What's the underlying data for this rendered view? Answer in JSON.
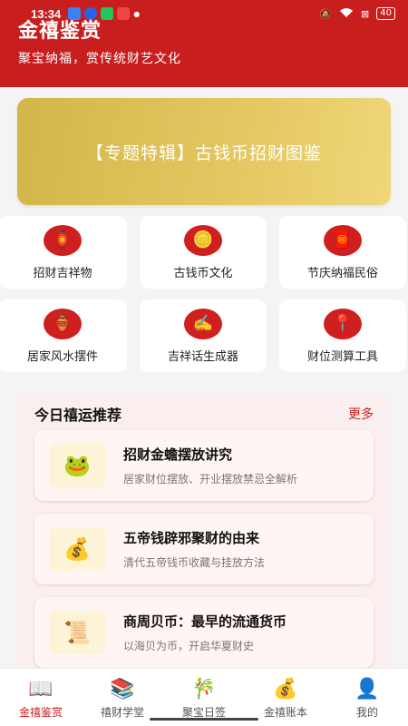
{
  "status": {
    "time": "13:34",
    "battery": "40"
  },
  "header": {
    "title": "金禧鉴赏",
    "subtitle": "聚宝纳福，赏传统财艺文化"
  },
  "banner": {
    "text": "【专题特辑】古钱币招财图鉴"
  },
  "categories": [
    {
      "label": "招财吉祥物",
      "icon": "lantern-icon",
      "glyph": "🏮"
    },
    {
      "label": "古钱币文化",
      "icon": "coin-icon",
      "glyph": "🪙"
    },
    {
      "label": "节庆纳福民俗",
      "icon": "red-envelope-icon",
      "glyph": "🧧"
    },
    {
      "label": "居家风水摆件",
      "icon": "vase-icon",
      "glyph": "🏺"
    },
    {
      "label": "吉祥话生成器",
      "icon": "writing-hand-icon",
      "glyph": "✍️"
    },
    {
      "label": "财位测算工具",
      "icon": "pin-icon",
      "glyph": "📍"
    }
  ],
  "recommend": {
    "title": "今日禧运推荐",
    "more": "更多",
    "items": [
      {
        "title": "招财金蟾摆放讲究",
        "desc": "居家财位摆放、开业摆放禁忌全解析",
        "icon": "frog-icon",
        "glyph": "🐸"
      },
      {
        "title": "五帝钱辟邪聚财的由来",
        "desc": "清代五帝钱币收藏与挂放方法",
        "icon": "money-bag-icon",
        "glyph": "💰"
      },
      {
        "title": "商周贝币：最早的流通货币",
        "desc": "以海贝为币，开启华夏财史",
        "icon": "scroll-icon",
        "glyph": "📜"
      }
    ]
  },
  "tabs": [
    {
      "label": "金禧鉴赏",
      "icon": "book-icon",
      "glyph": "📖",
      "active": true
    },
    {
      "label": "禧财学堂",
      "icon": "books-icon",
      "glyph": "📚",
      "active": false
    },
    {
      "label": "聚宝日签",
      "icon": "bamboo-icon",
      "glyph": "🎋",
      "active": false
    },
    {
      "label": "金禧账本",
      "icon": "money-bag-icon",
      "glyph": "💰",
      "active": false
    },
    {
      "label": "我的",
      "icon": "user-icon",
      "glyph": "👤",
      "active": false
    }
  ],
  "colors": {
    "brand_red": "#c81e1e",
    "banner_gold": "#e3c65e",
    "card_pink": "#fbeeee"
  }
}
